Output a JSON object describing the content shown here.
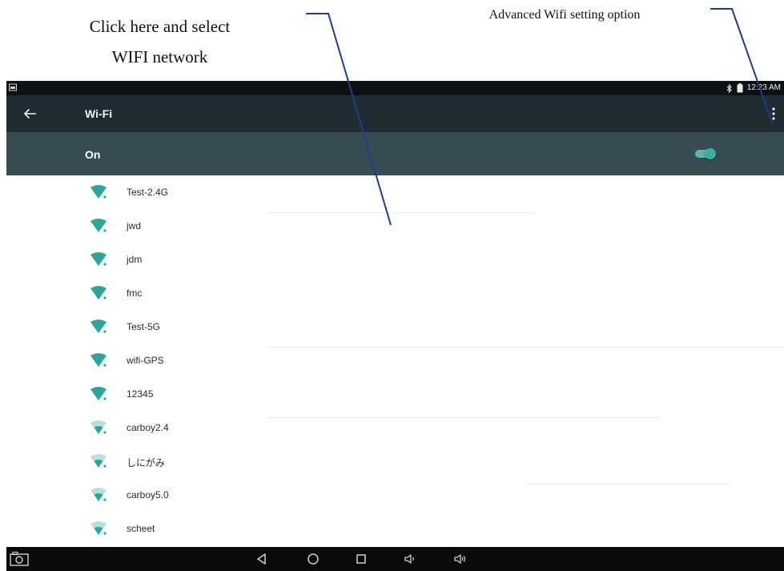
{
  "annotations": {
    "network_line1": "Click here and select",
    "network_line2": "WIFI network",
    "advanced": "Advanced Wifi setting option"
  },
  "status_bar": {
    "time": "12:23 AM",
    "icons": [
      "screenshot-notification-icon",
      "bluetooth-icon",
      "battery-icon"
    ]
  },
  "app_bar": {
    "title": "Wi-Fi",
    "back_icon": "arrow-left-icon",
    "menu_icon": "overflow-menu-icon"
  },
  "wifi_switch": {
    "label": "On",
    "state": "on"
  },
  "networks": [
    {
      "ssid": "Test-2.4G",
      "signal": "full"
    },
    {
      "ssid": "jwd",
      "signal": "full"
    },
    {
      "ssid": "jdm",
      "signal": "full"
    },
    {
      "ssid": "fmc",
      "signal": "full"
    },
    {
      "ssid": "Test-5G",
      "signal": "full"
    },
    {
      "ssid": "wifi-GPS",
      "signal": "full"
    },
    {
      "ssid": "12345",
      "signal": "full"
    },
    {
      "ssid": "carboy2.4",
      "signal": "medium"
    },
    {
      "ssid": "しにがみ",
      "signal": "medium"
    },
    {
      "ssid": "carboy5.0",
      "signal": "medium"
    },
    {
      "ssid": "scheet",
      "signal": "medium"
    }
  ],
  "nav_bar": {
    "icons": [
      "camera-icon",
      "back-icon",
      "home-icon",
      "recents-icon",
      "volume-down-icon",
      "volume-up-icon"
    ]
  },
  "colors": {
    "appbar": "#1f2c31",
    "switchbar": "#374b52",
    "accent": "#2aa79a"
  }
}
